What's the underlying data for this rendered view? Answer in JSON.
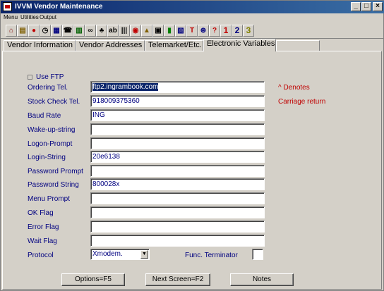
{
  "window": {
    "title": "IVVM  Vendor Maintenance",
    "min_glyph": "_",
    "max_glyph": "□",
    "close_glyph": "×"
  },
  "menu": [
    "Menu",
    "Utilities",
    "Output"
  ],
  "toolbar": [
    {
      "name": "home-icon",
      "glyph": "⌂",
      "color": "#800000"
    },
    {
      "name": "document-icon",
      "glyph": "▤",
      "color": "#806000"
    },
    {
      "name": "cherries-icon",
      "glyph": "●",
      "color": "#c00000"
    },
    {
      "name": "clock-icon",
      "glyph": "◷",
      "color": "#000000"
    },
    {
      "name": "calendar-icon",
      "glyph": "▦",
      "color": "#000080"
    },
    {
      "name": "phone-icon",
      "glyph": "☎",
      "color": "#000000"
    },
    {
      "name": "calculator-icon",
      "glyph": "▥",
      "color": "#006000"
    },
    {
      "name": "binoculars-icon",
      "glyph": "∞",
      "color": "#000000"
    },
    {
      "name": "people-icon",
      "glyph": "♣",
      "color": "#000000"
    },
    {
      "name": "abc-icon",
      "glyph": "ab",
      "color": "#000000"
    },
    {
      "name": "barcode-icon",
      "glyph": "|||",
      "color": "#000000"
    },
    {
      "name": "target-icon",
      "glyph": "◉",
      "color": "#c00000"
    },
    {
      "name": "lock-icon",
      "glyph": "▲",
      "color": "#806000"
    },
    {
      "name": "stamp-icon",
      "glyph": "▣",
      "color": "#000000"
    },
    {
      "name": "chart-icon",
      "glyph": "▮",
      "color": "#008000"
    },
    {
      "name": "picture-icon",
      "glyph": "▧",
      "color": "#000080"
    },
    {
      "name": "text-size-icon",
      "glyph": "T",
      "color": "#c00000"
    },
    {
      "name": "circle-arrow-icon",
      "glyph": "⊛",
      "color": "#000080"
    },
    {
      "name": "help-icon",
      "glyph": "?",
      "color": "#c00000"
    },
    {
      "name": "screen-1-button",
      "glyph": "1",
      "color": "#c00000"
    },
    {
      "name": "screen-2-button",
      "glyph": "2",
      "color": "#000080"
    },
    {
      "name": "screen-3-button",
      "glyph": "3",
      "color": "#808000"
    }
  ],
  "tabs": [
    "Vendor Information",
    "Vendor Addresses",
    "Telemarket/Etc.",
    "Electronic Variables"
  ],
  "form": {
    "use_ftp_label": "Use FTP",
    "fields": [
      {
        "label": "Ordering Tel.",
        "value": "ftp2.ingrambook.com"
      },
      {
        "label": "Stock Check Tel.",
        "value": "918009375360"
      },
      {
        "label": "Baud Rate",
        "value": "ING"
      },
      {
        "label": "Wake-up-string",
        "value": ""
      },
      {
        "label": "Logon-Prompt",
        "value": ""
      },
      {
        "label": "Login-String",
        "value": "20e6138"
      },
      {
        "label": "Password Prompt",
        "value": ""
      },
      {
        "label": "Password String",
        "value": "800028x"
      },
      {
        "label": "Menu Prompt",
        "value": ""
      },
      {
        "label": "OK Flag",
        "value": ""
      },
      {
        "label": "Error Flag",
        "value": ""
      },
      {
        "label": "Wait Flag",
        "value": ""
      }
    ],
    "protocol_label": "Protocol",
    "protocol_value": "Xmodem.",
    "func_terminator_label": "Func. Terminator",
    "note_line1": "^  Denotes",
    "note_line2": "Carriage return"
  },
  "buttons": {
    "options": "Options=F5",
    "next_screen": "Next Screen=F2",
    "notes": "Notes"
  }
}
